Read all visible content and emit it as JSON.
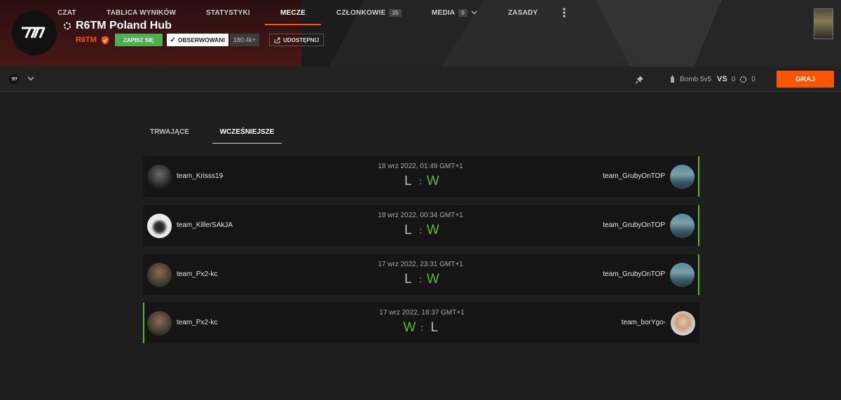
{
  "header": {
    "hub_title": "R6TM Poland Hub",
    "org_name": "R6TM",
    "join_label": "ZAPISZ SIĘ",
    "follow_label": "OBSERWOWANI",
    "followers": "180.4k+",
    "share_label": "UDOSTĘPNIJ"
  },
  "nav": {
    "items": [
      {
        "label": "CZAT"
      },
      {
        "label": "TABLICA WYNIKÓW"
      },
      {
        "label": "STATYSTYKI"
      },
      {
        "label": "MECZE"
      },
      {
        "label": "CZŁONKOWIE",
        "count": "35"
      },
      {
        "label": "MEDIA",
        "count": "0"
      },
      {
        "label": "ZASADY"
      }
    ],
    "queue_mode": "Bomb 5v5",
    "vs_label": "VS",
    "count_a": "0",
    "count_b": "0",
    "play_label": "GRAJ"
  },
  "tabs": {
    "ongoing": "TRWAJĄCE",
    "past": "WCZEŚNIEJSZE"
  },
  "matches": [
    {
      "date": "18 wrz 2022, 01:49 GMT+1",
      "team_left": "team_Krisss19",
      "team_right": "team_GrubyOnTOP",
      "res_left": "L",
      "res_right": "W"
    },
    {
      "date": "18 wrz 2022, 00:34 GMT+1",
      "team_left": "team_KillerSAkJA",
      "team_right": "team_GrubyOnTOP",
      "res_left": "L",
      "res_right": "W"
    },
    {
      "date": "17 wrz 2022, 23:31 GMT+1",
      "team_left": "team_Px2-kc",
      "team_right": "team_GrubyOnTOP",
      "res_left": "L",
      "res_right": "W"
    },
    {
      "date": "17 wrz 2022, 18:37 GMT+1",
      "team_left": "team_Px2-kc",
      "team_right": "team_borYgo-",
      "res_left": "W",
      "res_right": "L"
    }
  ],
  "colors": {
    "accent": "#ff5500",
    "win": "#5fb832",
    "join": "#4caf50"
  }
}
